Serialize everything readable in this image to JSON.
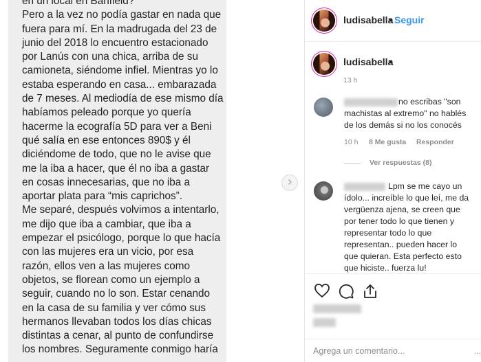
{
  "story": {
    "text": "en un local en Banfield?\nPero a la vez no podía gastar en nada que\nfuera para mí. En la madrugada del 23 de\njunio del 2018 lo encuentro estacionado\npor Lanús con una chica, arriba de su\ncamioneta, siéndome infiel. Mientras yo lo\nestaba esperando en casa... embarazada\nde 7 meses. Al mediodía de ese mismo día\nhabíamos peleado porque yo quería\nhacerme la ecografía 5D para ver a Beni\nqué salía en ese entonces 890$ y él\ndiciéndome de todo, que no le avise que\nme la iba a hacer, que él no iba a gastar\nen cosas innecesarias, que no iba a\naportar plata para “mis caprichos”.\nMe separé, después volvimos a intentarlo,\nme dijo que iba a cambiar, que iba a\nempezar el psicólogo, porque lo que hacía\ncon las mujeres era un vicio, por esa\nrazón, ellos ven a las mujeres como\nobjetos, se florean como un ejemplo a\nseguir, cuando no lo son. Estar cenando\nen la casa de su familia y ver cómo sus\nhermanos llevaban todos los días chicas\ndistintas a cenar, al punto de confundirse\nlos nombres. Seguramente conmigo haría"
  },
  "header": {
    "username": "ludisabella",
    "separator": "•",
    "follow_label": "Seguir"
  },
  "caption": {
    "username": "ludisabella",
    "separator": "•",
    "time": "13 h"
  },
  "comments": [
    {
      "text": "no escribas \"son\nmachistas al extremo\" no hablés\nde los demás si no los conocés",
      "time": "10 h",
      "likes": "8 Me gusta",
      "reply_label": "Responder",
      "replies_label": "Ver respuestas (8)"
    },
    {
      "text": "Lpm se me cayo un\nídolo... increíble lo que leí, me da\nvergüenza ajena, se creen que\npor tener todo lo que tienen y\nrepresentar todo lo que\nrepresentan.. pueden hacer lo\nque quieran. Esta perfecto esto\nque hiciste.. fuerza lu!"
    }
  ],
  "comment_box": {
    "placeholder": "Agrega un comentario...",
    "more": "..."
  },
  "icons": [
    "chevron-right-icon",
    "heart-icon",
    "comment-icon",
    "share-icon"
  ],
  "colors": {
    "link": "#3897f0",
    "muted": "#8e8e8e",
    "text": "#262626",
    "story_bg": "#eeeeee"
  }
}
